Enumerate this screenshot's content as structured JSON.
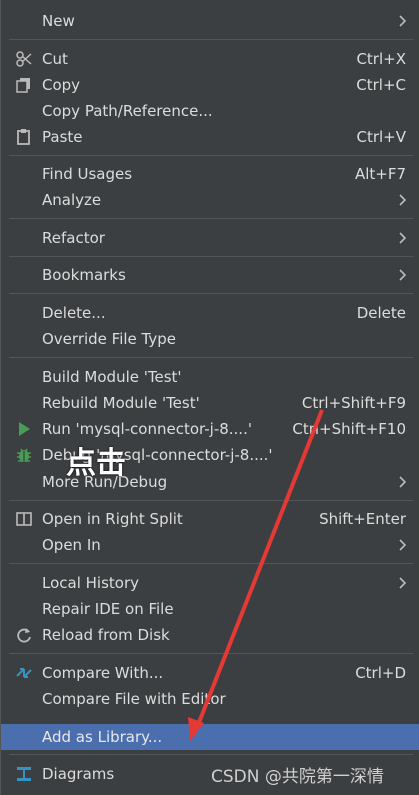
{
  "menu": {
    "new": {
      "label": "New",
      "arrow": true
    },
    "cut": {
      "label": "Cut",
      "shortcut": "Ctrl+X",
      "icon": "scissors-icon"
    },
    "copy": {
      "label": "Copy",
      "shortcut": "Ctrl+C",
      "icon": "copy-icon"
    },
    "copy_path": {
      "label": "Copy Path/Reference..."
    },
    "paste": {
      "label": "Paste",
      "shortcut": "Ctrl+V",
      "icon": "clipboard-icon"
    },
    "find_usages": {
      "label": "Find Usages",
      "shortcut": "Alt+F7"
    },
    "analyze": {
      "label": "Analyze",
      "arrow": true
    },
    "refactor": {
      "label": "Refactor",
      "arrow": true
    },
    "bookmarks": {
      "label": "Bookmarks",
      "arrow": true
    },
    "delete": {
      "label": "Delete...",
      "shortcut": "Delete"
    },
    "override_type": {
      "label": "Override File Type"
    },
    "build_module": {
      "label": "Build Module 'Test'"
    },
    "rebuild_module": {
      "label": "Rebuild Module 'Test'",
      "shortcut": "Ctrl+Shift+F9"
    },
    "run": {
      "label": "Run 'mysql-connector-j-8....'",
      "shortcut": "Ctrl+Shift+F10",
      "icon": "run-icon"
    },
    "debug": {
      "label": "Debug 'mysql-connector-j-8....'",
      "icon": "bug-icon"
    },
    "more_run": {
      "label": "More Run/Debug",
      "arrow": true
    },
    "open_right": {
      "label": "Open in Right Split",
      "shortcut": "Shift+Enter",
      "icon": "split-icon"
    },
    "open_in": {
      "label": "Open In",
      "arrow": true
    },
    "local_history": {
      "label": "Local History",
      "arrow": true
    },
    "repair_ide": {
      "label": "Repair IDE on File"
    },
    "reload": {
      "label": "Reload from Disk",
      "icon": "reload-icon"
    },
    "compare_with": {
      "label": "Compare With...",
      "shortcut": "Ctrl+D",
      "icon": "compare-icon"
    },
    "compare_editor": {
      "label": "Compare File with Editor"
    },
    "add_library": {
      "label": "Add as Library..."
    },
    "diagrams": {
      "label": "Diagrams",
      "icon": "diagram-icon"
    }
  },
  "annotation": {
    "text": "点击"
  },
  "watermark": {
    "text": "CSDN @共院第一深情"
  },
  "colors": {
    "background": "#3c3f41",
    "selected": "#4b6eaf",
    "arrow": "#e53935"
  }
}
